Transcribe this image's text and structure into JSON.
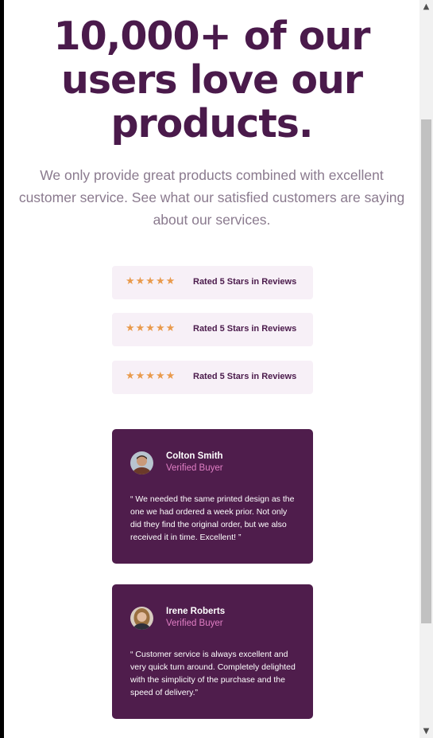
{
  "headline": "10,000+ of our users love our products.",
  "intro": "We only provide great products combined with excellent customer service. See what our satisfied customers are saying about our services.",
  "ratings": [
    {
      "stars": "★★★★★",
      "text": "Rated 5 Stars in Reviews"
    },
    {
      "stars": "★★★★★",
      "text": "Rated 5 Stars in Reviews"
    },
    {
      "stars": "★★★★★",
      "text": "Rated 5 Stars in Reviews"
    }
  ],
  "reviews": [
    {
      "name": "Colton Smith",
      "role": "Verified Buyer",
      "quote": "“ We needed the same printed design as the one we had ordered a week prior. Not only did they find the original order, but we also received it in time. Excellent! ”",
      "avatar": "colton-avatar"
    },
    {
      "name": "Irene Roberts",
      "role": "Verified Buyer",
      "quote": "“ Customer service is always excellent and very quick turn around. Completely delighted with the simplicity of the purchase and the speed of delivery.”",
      "avatar": "irene-avatar"
    }
  ],
  "colors": {
    "heading": "#4a1a4b",
    "intro_text": "#8a7a8e",
    "rating_bg": "#f7f0f7",
    "star": "#e99a4c",
    "card_bg": "#4f1d4c",
    "accent": "#e07ec4"
  },
  "scrollbar": {
    "up_icon": "▲",
    "down_icon": "▼"
  }
}
